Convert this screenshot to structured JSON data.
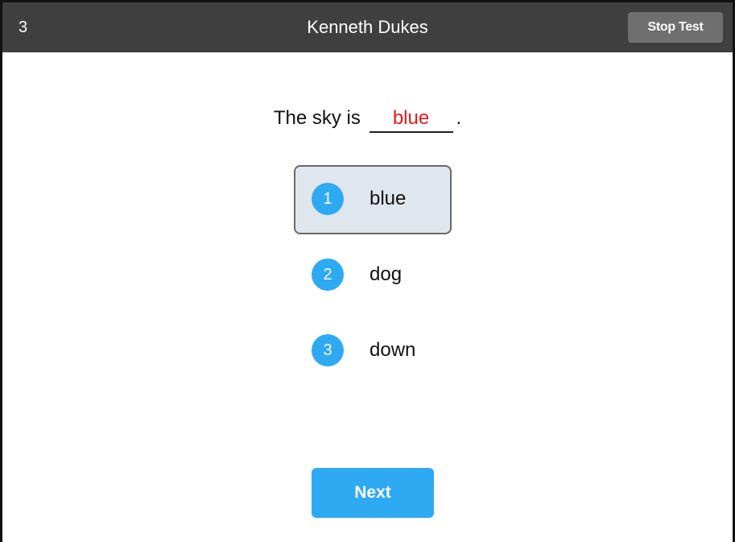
{
  "header": {
    "question_number": "3",
    "student_name": "Kenneth Dukes",
    "stop_label": "Stop Test"
  },
  "question": {
    "prefix": "The sky is",
    "answer": "blue",
    "suffix": "."
  },
  "options": [
    {
      "number": "1",
      "label": "blue",
      "selected": true
    },
    {
      "number": "2",
      "label": "dog",
      "selected": false
    },
    {
      "number": "3",
      "label": "down",
      "selected": false
    }
  ],
  "footer": {
    "next_label": "Next"
  },
  "colors": {
    "header_bg": "#3f3f3f",
    "accent": "#2eaaf3",
    "answer_text": "#e21b1b",
    "selected_bg": "#dfe6ee"
  }
}
